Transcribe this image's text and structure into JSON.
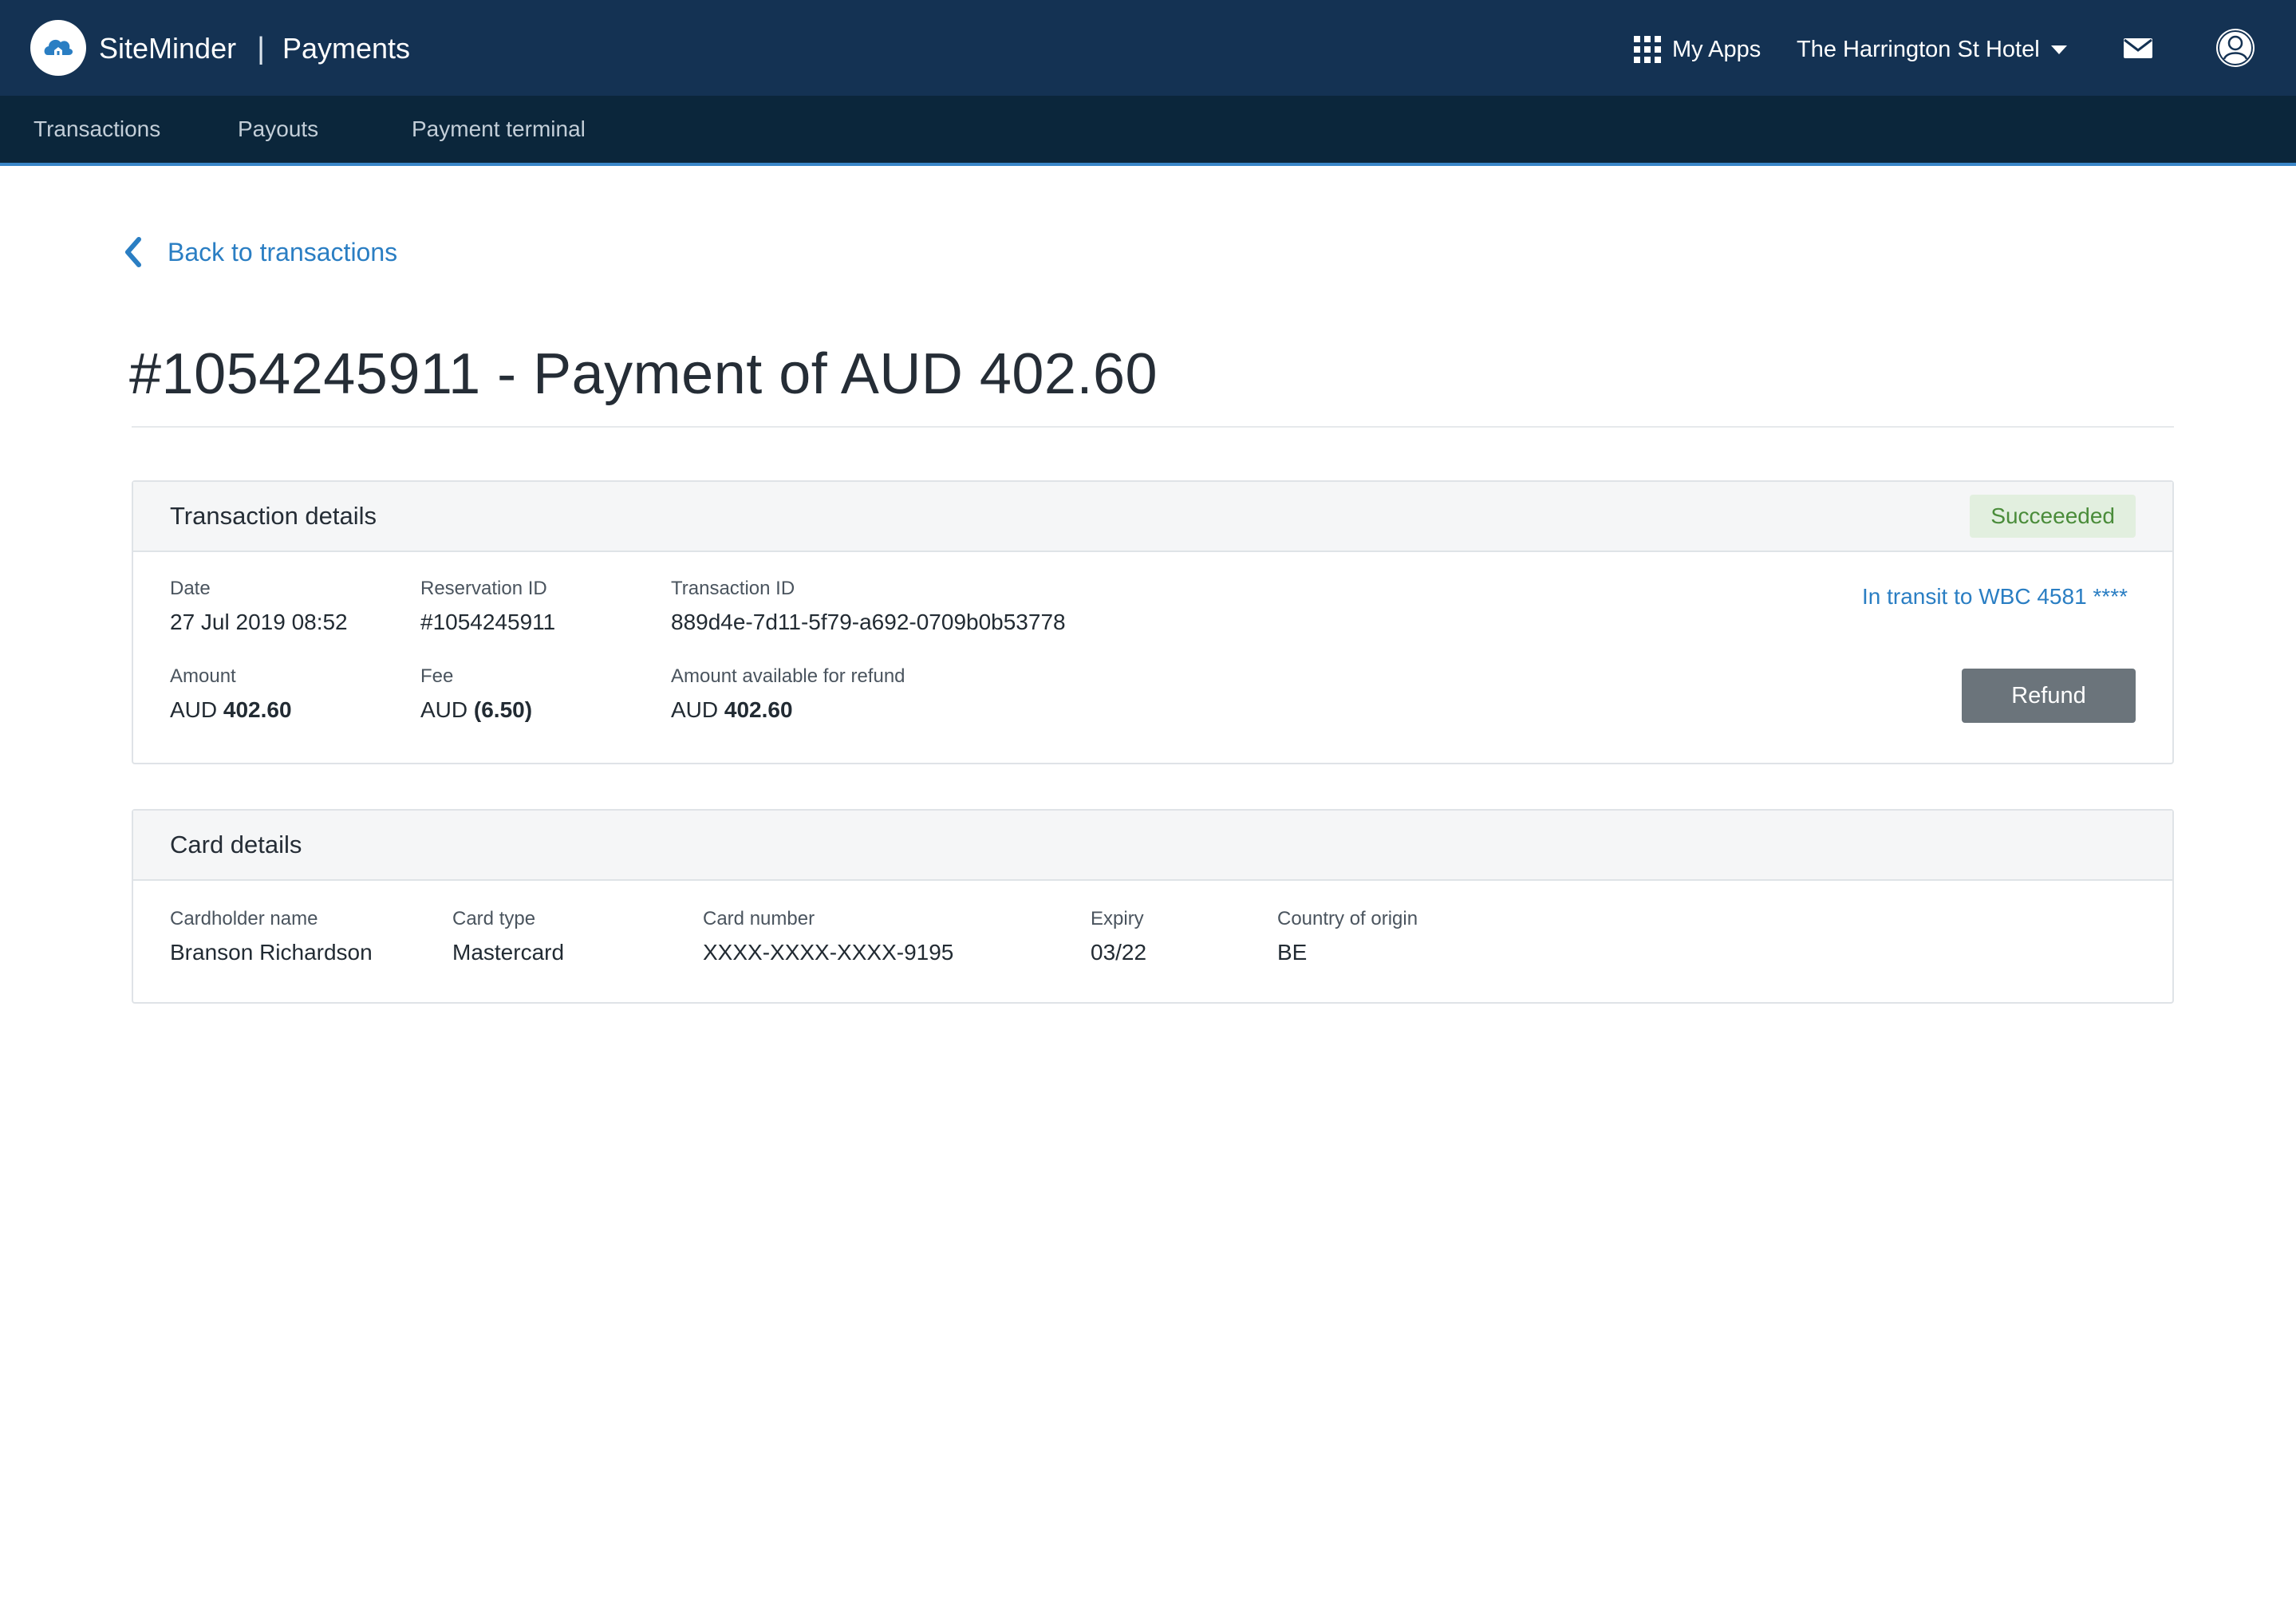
{
  "header": {
    "brand": "SiteMinder",
    "separator": "|",
    "product": "Payments",
    "my_apps": "My Apps",
    "hotel": "The Harrington St Hotel",
    "icons": [
      "siteminder-logo-icon",
      "apps-grid-icon",
      "chevron-down-icon",
      "mail-icon",
      "user-icon"
    ]
  },
  "subnav": {
    "items": [
      {
        "label": "Transactions"
      },
      {
        "label": "Payouts"
      },
      {
        "label": "Payment terminal"
      }
    ]
  },
  "back_link": {
    "label": "Back to transactions"
  },
  "page_title": "#1054245911 - Payment of AUD 402.60",
  "transaction_details": {
    "title": "Transaction details",
    "status": "Succeeeded",
    "transit_text": "In transit to WBC 4581 ****",
    "refund_label": "Refund",
    "date": {
      "label": "Date",
      "value": "27 Jul 2019 08:52"
    },
    "reservation_id": {
      "label": "Reservation ID",
      "value": "#1054245911"
    },
    "transaction_id": {
      "label": "Transaction ID",
      "value": "889d4e-7d11-5f79-a692-0709b0b53778"
    },
    "amount": {
      "label": "Amount",
      "currency": "AUD",
      "value": "402.60"
    },
    "fee": {
      "label": "Fee",
      "currency": "AUD",
      "value": "(6.50)"
    },
    "refund_available": {
      "label": "Amount available for refund",
      "currency": "AUD",
      "value": "402.60"
    }
  },
  "card_details": {
    "title": "Card details",
    "cardholder": {
      "label": "Cardholder name",
      "value": "Branson Richardson"
    },
    "card_type": {
      "label": "Card type",
      "value": "Mastercard"
    },
    "card_number": {
      "label": "Card number",
      "value": "XXXX-XXXX-XXXX-9195"
    },
    "expiry": {
      "label": "Expiry",
      "value": "03/22"
    },
    "country": {
      "label": "Country of origin",
      "value": "BE"
    }
  },
  "colors": {
    "topbar": "#143253",
    "subnav": "#0b263b",
    "accent": "#2a7ec3",
    "success_bg": "#e2efdf",
    "success_text": "#4a8c3a",
    "refund_button": "#6b747b"
  }
}
